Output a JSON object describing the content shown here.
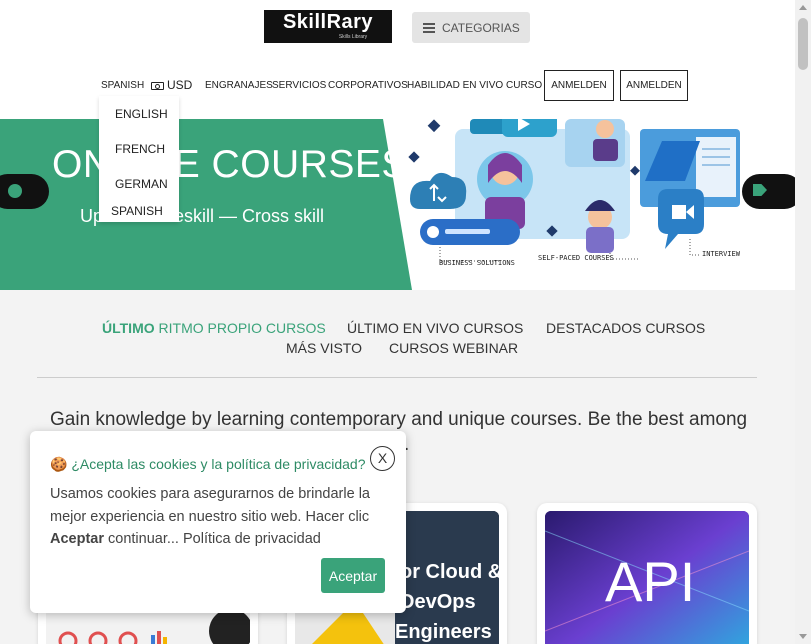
{
  "header": {
    "logo_text": "SkillRary",
    "logo_tagline": "Skills Library",
    "categories_button": "CATEGORIAS"
  },
  "nav": {
    "language": "SPANISH",
    "currency": "USD",
    "items": [
      "ENGRANAJES",
      "SERVICIOS",
      "CORPORATIVOS",
      "HABILIDAD EN VIVO",
      "CURSO"
    ],
    "login_buttons": [
      "ANMELDEN",
      "ANMELDEN"
    ]
  },
  "language_menu": [
    "ENGLISH",
    "FRENCH",
    "GERMAN",
    "SPANISH"
  ],
  "banner": {
    "title": "ONLINE COURSES",
    "subtitle": "Upskill — Reskill — Cross skill",
    "illustration_labels": [
      "BUSINESS SOLUTIONS",
      "SELF-PACED COURSES",
      "INTERVIEW"
    ]
  },
  "course_tabs": {
    "active_prefix": "ÚLTIMO",
    "active_rest": " RITMO PROPIO CURSOS",
    "others": [
      "ÚLTIMO EN VIVO CURSOS",
      "DESTACADOS CURSOS",
      "MÁS VISTO",
      "CURSOS WEBINAR"
    ]
  },
  "intro_text": "Gain knowledge by learning contemporary and unique courses. Be the best among",
  "intro_text_end": ".",
  "cards": [
    {
      "image": "dashboard-course-image"
    },
    {
      "image": "cloud-devops-course-image",
      "overlay_text": "or Cloud &\nDevOps\nEngineers"
    },
    {
      "image": "api-course-image",
      "overlay_text": "API"
    }
  ],
  "cookie_popup": {
    "title_icon": "🍪",
    "title": "¿Acepta las cookies y la política de privacidad?",
    "close_label": "X",
    "body_part1": "Usamos cookies para asegurarnos de brindarle la mejor experiencia en nuestro sitio web. Hacer clic ",
    "body_bold": "Aceptar",
    "body_part2": " continuar... Política de privacidad",
    "accept_label": "Aceptar"
  },
  "colors": {
    "accent_green": "#3aa37a",
    "dark": "#111111"
  }
}
